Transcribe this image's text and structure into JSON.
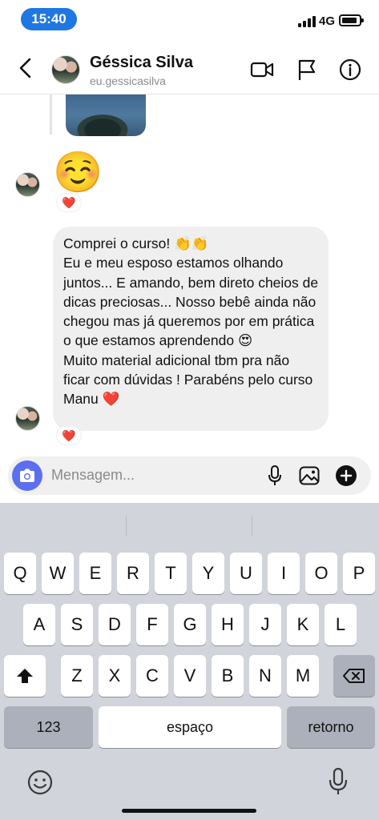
{
  "status_bar": {
    "time": "15:40",
    "network": "4G"
  },
  "header": {
    "name": "Géssica Silva",
    "handle": "eu.gessicasilva"
  },
  "messages": {
    "emoji": "☺️",
    "emoji_reaction": "❤️",
    "text": "Comprei o curso! 👏👏\nEu e meu esposo estamos olhando juntos... E amando, bem direto cheios de dicas preciosas... Nosso bebê ainda não chegou mas já queremos por em prática o que estamos aprendendo 😍\nMuito material adicional tbm pra não ficar com dúvidas ! Parabéns pelo curso Manu ❤️",
    "text_reaction": "❤️"
  },
  "composer": {
    "placeholder": "Mensagem..."
  },
  "keyboard": {
    "row1": [
      "Q",
      "W",
      "E",
      "R",
      "T",
      "Y",
      "U",
      "I",
      "O",
      "P"
    ],
    "row2": [
      "A",
      "S",
      "D",
      "F",
      "G",
      "H",
      "J",
      "K",
      "L"
    ],
    "row3": [
      "Z",
      "X",
      "C",
      "V",
      "B",
      "N",
      "M"
    ],
    "numbers": "123",
    "space": "espaço",
    "return": "retorno"
  },
  "colors": {
    "accent": "#1f77e4",
    "camera": "#5b6ff0",
    "bubble": "#efefef",
    "keyboard": "#d1d4da"
  },
  "icons": [
    "back-icon",
    "video-call-icon",
    "flag-icon",
    "info-icon",
    "camera-icon",
    "microphone-icon",
    "gallery-icon",
    "add-icon",
    "shift-icon",
    "backspace-icon",
    "emoji-icon",
    "dictation-icon"
  ]
}
